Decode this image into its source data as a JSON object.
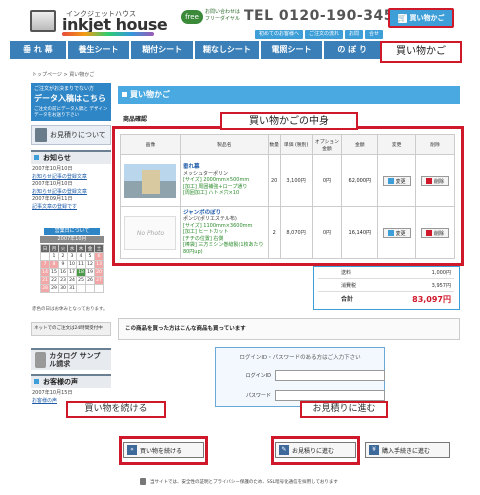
{
  "header": {
    "logo_kana": "インクジェットハウス",
    "logo_name": "inkjet house",
    "phone_label_1": "お問い合わせは",
    "phone_label_2": "フリーダイヤル",
    "phone_icon": "free",
    "phone_number": "TEL 0120-190-345",
    "cart_button": "買い物かご",
    "sublinks": [
      "初めてのお客様へ",
      "ご注文の流れ",
      "お問",
      "合せ"
    ]
  },
  "nav": {
    "items": [
      "垂 れ 幕",
      "養生シート",
      "糊付シート",
      "糊なしシート",
      "電照シート",
      "の ぼ り"
    ],
    "callout": "買い物かご"
  },
  "breadcrumb": "トップページ > 買い物かご",
  "sidebar": {
    "banner_line1": "ご注文がお決まりでない方",
    "banner_line2": "データ入稿はこちら",
    "banner_line3": "ご注文の前にデータ入稿と デザインデータをお送り下さい",
    "quote": "お見積りについて",
    "news_head": "お知らせ",
    "news": [
      {
        "date": "2007年10月10日",
        "link": "お知らせ記事の登録文章"
      },
      {
        "date": "2007年10月10日",
        "link": "お知らせ記事の登録文章"
      },
      {
        "date": "2007年09月11日",
        "link": "記事文章の登録です"
      }
    ],
    "cal_title": "営業日について",
    "cal_month": "2007年10月",
    "cal_days": [
      "日",
      "月",
      "火",
      "水",
      "木",
      "金",
      "土"
    ],
    "cal_weeks": [
      [
        "",
        "1",
        "2",
        "3",
        "4",
        "5",
        "6"
      ],
      [
        "7",
        "8",
        "9",
        "10",
        "11",
        "12",
        "13"
      ],
      [
        "14",
        "15",
        "16",
        "17",
        "18",
        "19",
        "20"
      ],
      [
        "21",
        "22",
        "23",
        "24",
        "25",
        "26",
        "27"
      ],
      [
        "28",
        "29",
        "30",
        "31",
        "",
        "",
        ""
      ]
    ],
    "cal_note": "赤色の日はお休みとなっております。",
    "mail_note": "ネットでのご注文は24時間受付中",
    "catalog": "カタログ サンプル請求",
    "voice_head": "お客様の声",
    "voice_date": "2007年10月15日",
    "voice_link": "お客様の声"
  },
  "main": {
    "title": "買い物かご",
    "confirm_label": "商品確認",
    "content_callout": "買い物かごの中身",
    "columns": [
      "画像",
      "製品名",
      "数量",
      "単価 (税別)",
      "オプション 金額",
      "金額",
      "変更",
      "削除"
    ],
    "rows": [
      {
        "thumb": "",
        "name": "垂れ幕",
        "lines": [
          "メッシュターポリン",
          "[サイズ] 2000mm×500mm",
          "[加工] 周囲補強+ロープ通り",
          "[周囲加工] ハトメ穴×10"
        ],
        "qty": "20",
        "unit": "3,100円",
        "option": "0円",
        "amount": "62,000円",
        "edit": "変更",
        "delete": "削除"
      },
      {
        "thumb": "No Photo",
        "name": "ジャンボのぼり",
        "lines": [
          "ポンジ(ポリエステル布)",
          "[サイズ] 1100mm×3600mm",
          "[加工] ヒートカット",
          "[チチの位置] 右側",
          "[棒袋] 三方ミシン巻縫製(1枚あたり80円up)"
        ],
        "qty": "2",
        "unit": "8,070円",
        "option": "0円",
        "amount": "16,140円",
        "edit": "変更",
        "delete": "削除"
      }
    ],
    "totals": [
      {
        "label": "送料",
        "value": "1,000円"
      },
      {
        "label": "消費税",
        "value": "3,957円"
      },
      {
        "label": "合計",
        "value": "83,097円"
      }
    ],
    "also_bought": "この商品を買った方はこんな商品も買っています",
    "login_title": "ログインID・パスワードのある方はご入力下さい",
    "login_id_label": "ログインID",
    "password_label": "パスワード",
    "callout_continue": "買い物を続ける",
    "callout_quote": "お見積りに進む",
    "btn_continue": "買い物を続ける",
    "btn_quote": "お見積りに進む",
    "btn_checkout": "購入手続きに進む",
    "footer_note": "当サイトでは、安全性の証明とプライバシー保護のため、SSL暗号化通信を採用しております"
  }
}
